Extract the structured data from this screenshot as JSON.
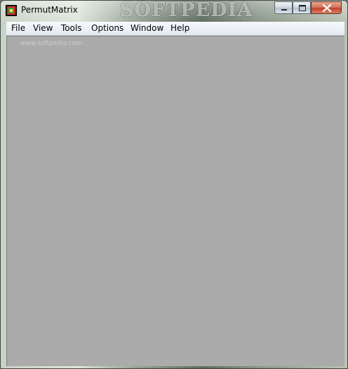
{
  "window": {
    "title": "PermutMatrix",
    "watermark": "SOFTPEDIA"
  },
  "controls": {
    "minimize": "minimize-icon",
    "maximize": "maximize-icon",
    "close": "close-icon"
  },
  "menu": {
    "file": "File",
    "view": "View",
    "tools": "Tools",
    "options": "Options",
    "window": "Window",
    "help": "Help"
  },
  "client": {
    "watermark": "www.softpedia.com"
  },
  "colors": {
    "client_background": "#ababab",
    "menubar": "#eef1f7",
    "close_button": "#c2432a"
  }
}
